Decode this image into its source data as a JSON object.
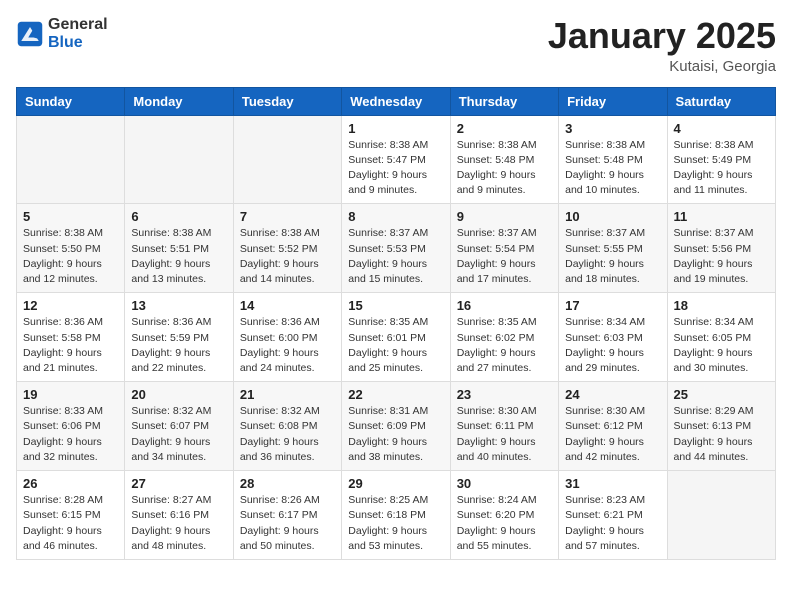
{
  "header": {
    "logo": {
      "general": "General",
      "blue": "Blue"
    },
    "title": "January 2025",
    "location": "Kutaisi, Georgia"
  },
  "weekdays": [
    "Sunday",
    "Monday",
    "Tuesday",
    "Wednesday",
    "Thursday",
    "Friday",
    "Saturday"
  ],
  "weeks": [
    [
      {
        "day": "",
        "info": ""
      },
      {
        "day": "",
        "info": ""
      },
      {
        "day": "",
        "info": ""
      },
      {
        "day": "1",
        "info": "Sunrise: 8:38 AM\nSunset: 5:47 PM\nDaylight: 9 hours\nand 9 minutes."
      },
      {
        "day": "2",
        "info": "Sunrise: 8:38 AM\nSunset: 5:48 PM\nDaylight: 9 hours\nand 9 minutes."
      },
      {
        "day": "3",
        "info": "Sunrise: 8:38 AM\nSunset: 5:48 PM\nDaylight: 9 hours\nand 10 minutes."
      },
      {
        "day": "4",
        "info": "Sunrise: 8:38 AM\nSunset: 5:49 PM\nDaylight: 9 hours\nand 11 minutes."
      }
    ],
    [
      {
        "day": "5",
        "info": "Sunrise: 8:38 AM\nSunset: 5:50 PM\nDaylight: 9 hours\nand 12 minutes."
      },
      {
        "day": "6",
        "info": "Sunrise: 8:38 AM\nSunset: 5:51 PM\nDaylight: 9 hours\nand 13 minutes."
      },
      {
        "day": "7",
        "info": "Sunrise: 8:38 AM\nSunset: 5:52 PM\nDaylight: 9 hours\nand 14 minutes."
      },
      {
        "day": "8",
        "info": "Sunrise: 8:37 AM\nSunset: 5:53 PM\nDaylight: 9 hours\nand 15 minutes."
      },
      {
        "day": "9",
        "info": "Sunrise: 8:37 AM\nSunset: 5:54 PM\nDaylight: 9 hours\nand 17 minutes."
      },
      {
        "day": "10",
        "info": "Sunrise: 8:37 AM\nSunset: 5:55 PM\nDaylight: 9 hours\nand 18 minutes."
      },
      {
        "day": "11",
        "info": "Sunrise: 8:37 AM\nSunset: 5:56 PM\nDaylight: 9 hours\nand 19 minutes."
      }
    ],
    [
      {
        "day": "12",
        "info": "Sunrise: 8:36 AM\nSunset: 5:58 PM\nDaylight: 9 hours\nand 21 minutes."
      },
      {
        "day": "13",
        "info": "Sunrise: 8:36 AM\nSunset: 5:59 PM\nDaylight: 9 hours\nand 22 minutes."
      },
      {
        "day": "14",
        "info": "Sunrise: 8:36 AM\nSunset: 6:00 PM\nDaylight: 9 hours\nand 24 minutes."
      },
      {
        "day": "15",
        "info": "Sunrise: 8:35 AM\nSunset: 6:01 PM\nDaylight: 9 hours\nand 25 minutes."
      },
      {
        "day": "16",
        "info": "Sunrise: 8:35 AM\nSunset: 6:02 PM\nDaylight: 9 hours\nand 27 minutes."
      },
      {
        "day": "17",
        "info": "Sunrise: 8:34 AM\nSunset: 6:03 PM\nDaylight: 9 hours\nand 29 minutes."
      },
      {
        "day": "18",
        "info": "Sunrise: 8:34 AM\nSunset: 6:05 PM\nDaylight: 9 hours\nand 30 minutes."
      }
    ],
    [
      {
        "day": "19",
        "info": "Sunrise: 8:33 AM\nSunset: 6:06 PM\nDaylight: 9 hours\nand 32 minutes."
      },
      {
        "day": "20",
        "info": "Sunrise: 8:32 AM\nSunset: 6:07 PM\nDaylight: 9 hours\nand 34 minutes."
      },
      {
        "day": "21",
        "info": "Sunrise: 8:32 AM\nSunset: 6:08 PM\nDaylight: 9 hours\nand 36 minutes."
      },
      {
        "day": "22",
        "info": "Sunrise: 8:31 AM\nSunset: 6:09 PM\nDaylight: 9 hours\nand 38 minutes."
      },
      {
        "day": "23",
        "info": "Sunrise: 8:30 AM\nSunset: 6:11 PM\nDaylight: 9 hours\nand 40 minutes."
      },
      {
        "day": "24",
        "info": "Sunrise: 8:30 AM\nSunset: 6:12 PM\nDaylight: 9 hours\nand 42 minutes."
      },
      {
        "day": "25",
        "info": "Sunrise: 8:29 AM\nSunset: 6:13 PM\nDaylight: 9 hours\nand 44 minutes."
      }
    ],
    [
      {
        "day": "26",
        "info": "Sunrise: 8:28 AM\nSunset: 6:15 PM\nDaylight: 9 hours\nand 46 minutes."
      },
      {
        "day": "27",
        "info": "Sunrise: 8:27 AM\nSunset: 6:16 PM\nDaylight: 9 hours\nand 48 minutes."
      },
      {
        "day": "28",
        "info": "Sunrise: 8:26 AM\nSunset: 6:17 PM\nDaylight: 9 hours\nand 50 minutes."
      },
      {
        "day": "29",
        "info": "Sunrise: 8:25 AM\nSunset: 6:18 PM\nDaylight: 9 hours\nand 53 minutes."
      },
      {
        "day": "30",
        "info": "Sunrise: 8:24 AM\nSunset: 6:20 PM\nDaylight: 9 hours\nand 55 minutes."
      },
      {
        "day": "31",
        "info": "Sunrise: 8:23 AM\nSunset: 6:21 PM\nDaylight: 9 hours\nand 57 minutes."
      },
      {
        "day": "",
        "info": ""
      }
    ]
  ]
}
